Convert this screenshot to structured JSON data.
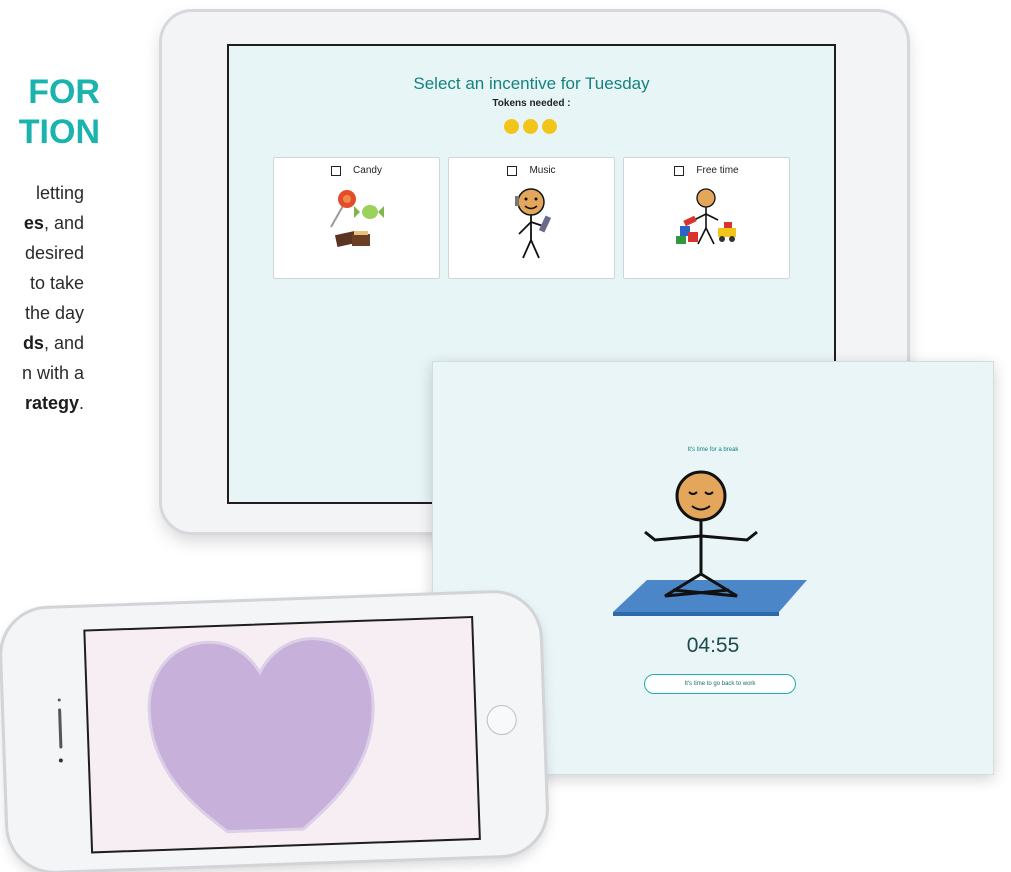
{
  "left": {
    "heading_lines": [
      "FOR",
      "TION"
    ],
    "body_lines": [
      {
        "text": "letting",
        "bold": false
      },
      {
        "text": "es",
        "bold": true,
        "suffix": ", and"
      },
      {
        "text": "desired",
        "bold": false
      },
      {
        "text": "to take",
        "bold": false
      },
      {
        "text": "the day",
        "bold": false
      },
      {
        "text": "ds",
        "bold": true,
        "suffix": ", and"
      },
      {
        "text": "n with a",
        "bold": false
      },
      {
        "text": "rategy",
        "bold": true,
        "suffix": "."
      }
    ]
  },
  "ipad": {
    "title": "Select an incentive for Tuesday",
    "tokens_label": "Tokens needed :",
    "tokens_count": 3,
    "token_color": "#f2c51a",
    "incentives": [
      {
        "label": "Candy",
        "icon": "candy-icon",
        "checked": false
      },
      {
        "label": "Music",
        "icon": "music-person-icon",
        "checked": false
      },
      {
        "label": "Free time",
        "icon": "free-time-toys-icon",
        "checked": false
      }
    ]
  },
  "break_screen": {
    "message": "It's time for a break",
    "figure_icon": "meditating-person-icon",
    "timer": "04:55",
    "button_label": "It's time to go back to work"
  },
  "iphone": {
    "screen_icon": "heart-icon",
    "heart_color": "#c7b0d9"
  },
  "colors": {
    "accent": "#1ab3ad",
    "screen_bg": "#e7f5f6",
    "title_teal": "#16827d"
  }
}
